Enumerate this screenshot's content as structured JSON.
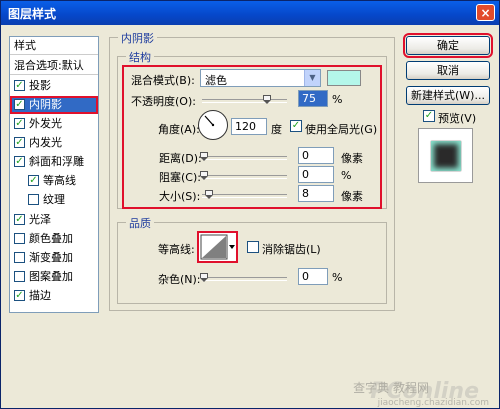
{
  "window": {
    "title": "图层样式",
    "close_glyph": "×"
  },
  "left_panel": {
    "items": [
      {
        "label": "样式",
        "checkbox": false,
        "checked": false
      },
      {
        "label": "混合选项:默认",
        "checkbox": false,
        "checked": false
      },
      {
        "label": "投影",
        "checkbox": true,
        "checked": true
      },
      {
        "label": "内阴影",
        "checkbox": true,
        "checked": true,
        "selected": true
      },
      {
        "label": "外发光",
        "checkbox": true,
        "checked": true
      },
      {
        "label": "内发光",
        "checkbox": true,
        "checked": true
      },
      {
        "label": "斜面和浮雕",
        "checkbox": true,
        "checked": true
      },
      {
        "label": "等高线",
        "checkbox": true,
        "checked": true,
        "indent": true
      },
      {
        "label": "纹理",
        "checkbox": true,
        "checked": false,
        "indent": true
      },
      {
        "label": "光泽",
        "checkbox": true,
        "checked": true
      },
      {
        "label": "颜色叠加",
        "checkbox": true,
        "checked": false
      },
      {
        "label": "渐变叠加",
        "checkbox": true,
        "checked": false
      },
      {
        "label": "图案叠加",
        "checkbox": true,
        "checked": false
      },
      {
        "label": "描边",
        "checkbox": true,
        "checked": true
      }
    ]
  },
  "inner_shadow": {
    "group_title": "内阴影",
    "structure": {
      "title": "结构",
      "blend_mode_label": "混合模式(B):",
      "blend_mode_value": "滤色",
      "color_swatch": "#b4f7ea",
      "opacity_label": "不透明度(O):",
      "opacity_value": "75",
      "opacity_unit": "%",
      "angle_label": "角度(A):",
      "angle_value": "120",
      "angle_unit": "度",
      "global_light_label": "使用全局光(G)",
      "global_light_checked": true,
      "distance_label": "距离(D):",
      "distance_value": "0",
      "distance_unit": "像素",
      "choke_label": "阻塞(C):",
      "choke_value": "0",
      "choke_unit": "%",
      "size_label": "大小(S):",
      "size_value": "8",
      "size_unit": "像素"
    },
    "quality": {
      "title": "品质",
      "contour_label": "等高线:",
      "anti_alias_label": "消除锯齿(L)",
      "anti_alias_checked": false,
      "noise_label": "杂色(N):",
      "noise_value": "0",
      "noise_unit": "%"
    }
  },
  "buttons": {
    "ok": "确定",
    "cancel": "取消",
    "new_style": "新建样式(W)...",
    "preview_label": "预览(V)",
    "preview_checked": true
  },
  "watermark": {
    "brand": "PConline",
    "sub": "查字典 教程网",
    "url": "jiaocheng.chazidian.com"
  },
  "colors": {
    "title_bar": "#0647c9",
    "highlight_red": "#e0102c",
    "selection": "#316ac5"
  }
}
